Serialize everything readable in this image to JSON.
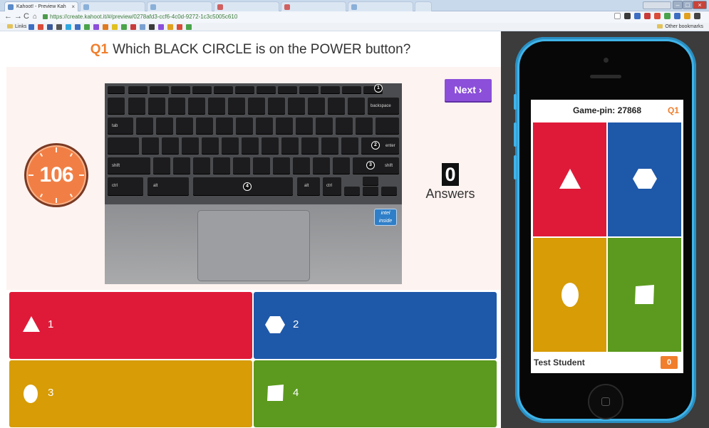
{
  "browser": {
    "tab_title": "Kahoot! - Preview Kah",
    "url": "https://create.kahoot.it/#/preview/0278afd3-ccf6-4c0d-9272-1c3c5005c610",
    "bookmark_links": "Links",
    "bookmark_other": "Other bookmarks"
  },
  "question": {
    "number": "Q1",
    "text": "Which BLACK CIRCLE is on the POWER button?"
  },
  "timer": "106",
  "next_label": "Next ›",
  "answers": {
    "count": "0",
    "label": "Answers"
  },
  "laptop_circles": [
    "1",
    "2",
    "3",
    "4"
  ],
  "laptop_labels": {
    "backspace": "backspace",
    "enter": "enter",
    "shift_left": "shift",
    "shift_right": "shift",
    "ctrl_left": "ctrl",
    "alt_left": "alt",
    "alt_right": "alt",
    "ctrl_right": "ctrl",
    "tab": "tab",
    "esc": "esc",
    "intel": "intel inside"
  },
  "options": [
    {
      "label": "1",
      "shape": "triangle",
      "color": "#df1a38"
    },
    {
      "label": "2",
      "shape": "hexagon",
      "color": "#1e58a9"
    },
    {
      "label": "3",
      "shape": "circle",
      "color": "#d79c06"
    },
    {
      "label": "4",
      "shape": "square",
      "color": "#5b9a1e"
    }
  ],
  "phone": {
    "pin_label": "Game-pin: 27868",
    "question_num": "Q1",
    "student": "Test Student",
    "score": "0"
  }
}
